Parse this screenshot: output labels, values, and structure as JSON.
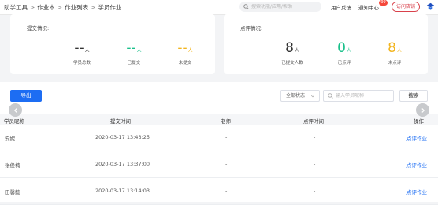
{
  "breadcrumb": [
    "助学工具",
    "作业本",
    "作业列表",
    "学员作业"
  ],
  "header": {
    "search_placeholder": "搜索功能/应用/帮助",
    "feedback": "用户反馈",
    "notice": "通知中心",
    "notice_badge": "99",
    "visit_store": "访问店铺",
    "logo_icon": "brand-logo-icon"
  },
  "submission": {
    "title": "提交情况:",
    "stats": [
      {
        "value": "--",
        "unit": "人",
        "label": "学员总数",
        "color": "#333333"
      },
      {
        "value": "--",
        "unit": "人",
        "label": "已提交",
        "color": "#19c08a"
      },
      {
        "value": "--",
        "unit": "人",
        "label": "未提交",
        "color": "#f2b51f"
      }
    ]
  },
  "review": {
    "title": "点评情况:",
    "stats": [
      {
        "value": "8",
        "unit": "人",
        "label": "已提交人数",
        "color": "#333333"
      },
      {
        "value": "0",
        "unit": "人",
        "label": "已点评",
        "color": "#19c08a"
      },
      {
        "value": "8",
        "unit": "人",
        "label": "未点评",
        "color": "#f2b51f"
      }
    ]
  },
  "toolbar": {
    "export": "导出",
    "status_select": "全部状态",
    "search_placeholder": "输入学员昵称",
    "search_button": "搜索"
  },
  "table": {
    "columns": [
      "学员昵称",
      "提交时间",
      "老师",
      "点评时间",
      "操作"
    ],
    "rows": [
      {
        "name": "安妮",
        "time": "2020-03-17 13:43:25",
        "teacher": "-",
        "review_time": "-",
        "action": "点评作业"
      },
      {
        "name": "张俊楠",
        "time": "2020-03-17 13:37:00",
        "teacher": "-",
        "review_time": "-",
        "action": "点评作业"
      },
      {
        "name": "田馨懿",
        "time": "2020-03-17 13:14:03",
        "teacher": "-",
        "review_time": "-",
        "action": "点评作业"
      }
    ]
  }
}
